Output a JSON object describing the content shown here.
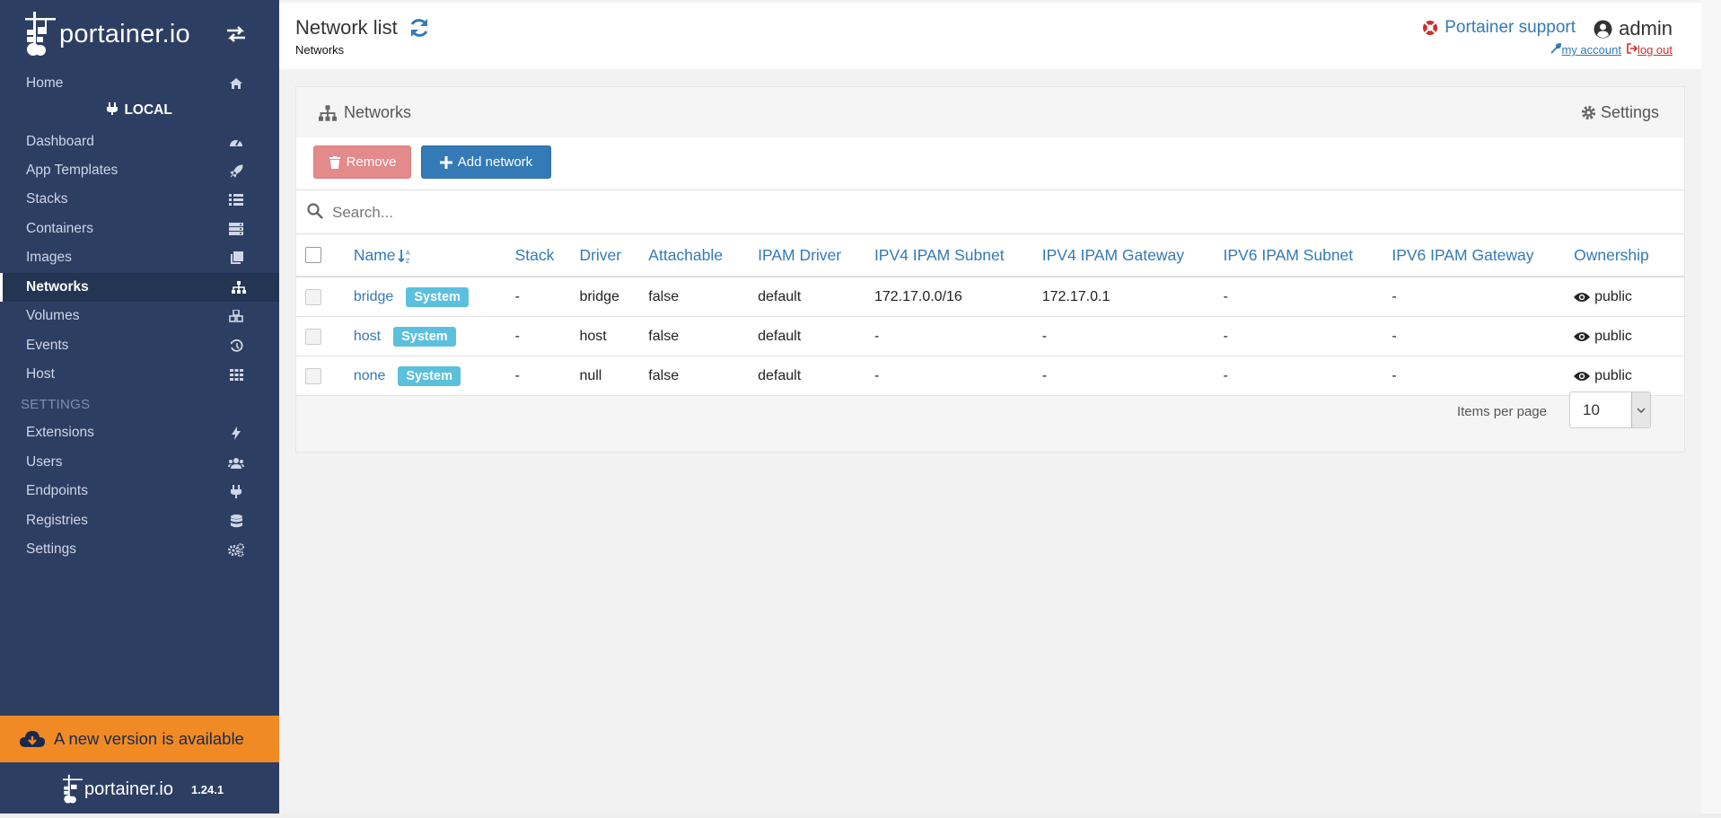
{
  "brand": {
    "name": "portainer.io",
    "version": "1.24.1"
  },
  "sidebar": {
    "home": {
      "label": "Home",
      "icon": "home-icon"
    },
    "endpoint_label": "LOCAL",
    "items": [
      {
        "label": "Dashboard",
        "icon": "dashboard-icon"
      },
      {
        "label": "App Templates",
        "icon": "rocket-icon"
      },
      {
        "label": "Stacks",
        "icon": "list-icon"
      },
      {
        "label": "Containers",
        "icon": "server-icon"
      },
      {
        "label": "Images",
        "icon": "clone-icon"
      },
      {
        "label": "Networks",
        "icon": "sitemap-icon",
        "active": true
      },
      {
        "label": "Volumes",
        "icon": "cubes-icon"
      },
      {
        "label": "Events",
        "icon": "history-icon"
      },
      {
        "label": "Host",
        "icon": "th-icon"
      }
    ],
    "settings_header": "SETTINGS",
    "settings_items": [
      {
        "label": "Extensions",
        "icon": "bolt-icon"
      },
      {
        "label": "Users",
        "icon": "users-icon"
      },
      {
        "label": "Endpoints",
        "icon": "plug-icon"
      },
      {
        "label": "Registries",
        "icon": "database-icon"
      },
      {
        "label": "Settings",
        "icon": "cogs-icon"
      }
    ],
    "update_banner": "A new version is available"
  },
  "header": {
    "title": "Network list",
    "breadcrumb": "Networks",
    "support_label": "Portainer support",
    "user_name": "admin",
    "my_account": "my account",
    "log_out": "log out"
  },
  "widget": {
    "title": "Networks",
    "settings_label": "Settings",
    "remove_label": "Remove",
    "add_label": "Add network",
    "search_placeholder": "Search...",
    "columns": [
      "Name",
      "Stack",
      "Driver",
      "Attachable",
      "IPAM Driver",
      "IPV4 IPAM Subnet",
      "IPV4 IPAM Gateway",
      "IPV6 IPAM Subnet",
      "IPV6 IPAM Gateway",
      "Ownership"
    ],
    "rows": [
      {
        "name": "bridge",
        "badge": "System",
        "stack": "-",
        "driver": "bridge",
        "attachable": "false",
        "ipam_driver": "default",
        "ipv4_subnet": "172.17.0.0/16",
        "ipv4_gateway": "172.17.0.1",
        "ipv6_subnet": "-",
        "ipv6_gateway": "-",
        "ownership": "public"
      },
      {
        "name": "host",
        "badge": "System",
        "stack": "-",
        "driver": "host",
        "attachable": "false",
        "ipam_driver": "default",
        "ipv4_subnet": "-",
        "ipv4_gateway": "-",
        "ipv6_subnet": "-",
        "ipv6_gateway": "-",
        "ownership": "public"
      },
      {
        "name": "none",
        "badge": "System",
        "stack": "-",
        "driver": "null",
        "attachable": "false",
        "ipam_driver": "default",
        "ipv4_subnet": "-",
        "ipv4_gateway": "-",
        "ipv6_subnet": "-",
        "ipv6_gateway": "-",
        "ownership": "public"
      }
    ],
    "items_per_page_label": "Items per page",
    "items_per_page_value": "10"
  },
  "colors": {
    "sidebar_bg": "#2d3e63",
    "accent": "#337ab7",
    "badge": "#5bc0de",
    "update_banner": "#f08a24",
    "danger": "#d9534f"
  }
}
